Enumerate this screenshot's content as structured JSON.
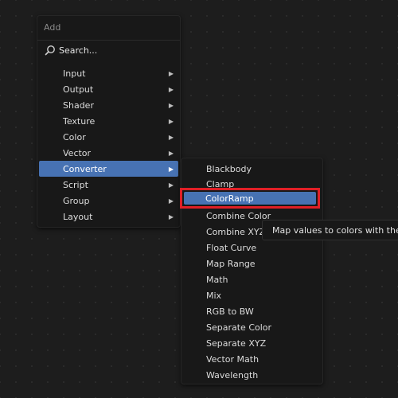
{
  "add_menu": {
    "title": "Add",
    "search_label": "Search...",
    "items": [
      {
        "label": "Input",
        "submenu": true
      },
      {
        "label": "Output",
        "submenu": true
      },
      {
        "label": "Shader",
        "submenu": true
      },
      {
        "label": "Texture",
        "submenu": true
      },
      {
        "label": "Color",
        "submenu": true
      },
      {
        "label": "Vector",
        "submenu": true
      },
      {
        "label": "Converter",
        "submenu": true,
        "active": true
      },
      {
        "label": "Script",
        "submenu": true
      },
      {
        "label": "Group",
        "submenu": true
      },
      {
        "label": "Layout",
        "submenu": true
      }
    ]
  },
  "converter_menu": {
    "items": [
      {
        "label": "Blackbody"
      },
      {
        "label": "Clamp"
      },
      {
        "label": "ColorRamp",
        "hovered": true
      },
      {
        "label": "Combine Color"
      },
      {
        "label": "Combine XYZ"
      },
      {
        "label": "Float Curve"
      },
      {
        "label": "Map Range"
      },
      {
        "label": "Math"
      },
      {
        "label": "Mix"
      },
      {
        "label": "RGB to BW"
      },
      {
        "label": "Separate Color"
      },
      {
        "label": "Separate XYZ"
      },
      {
        "label": "Vector Math"
      },
      {
        "label": "Wavelength"
      }
    ]
  },
  "tooltip": {
    "text": "Map values to colors with the us"
  },
  "colors": {
    "background": "#1d1d1d",
    "menu_bg": "#181818",
    "active_item": "#4772b3",
    "highlight_border": "#e01f26"
  },
  "icons": {
    "search": "search-icon",
    "submenu_arrow": "triangle-right-icon"
  }
}
